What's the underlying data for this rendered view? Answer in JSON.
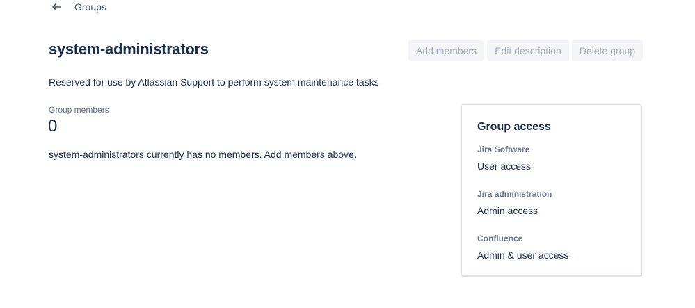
{
  "breadcrumb": {
    "back_icon": "arrow-left-icon",
    "label": "Groups"
  },
  "group": {
    "name": "system-administrators",
    "description": "Reserved for use by Atlassian Support to perform system maintenance tasks"
  },
  "actions": {
    "add_members": "Add members",
    "edit_description": "Edit description",
    "delete_group": "Delete group"
  },
  "members": {
    "label": "Group members",
    "count": "0",
    "empty_message": "system-administrators currently has no members. Add members above."
  },
  "group_access": {
    "title": "Group access",
    "items": [
      {
        "product": "Jira Software",
        "access": "User access"
      },
      {
        "product": "Jira administration",
        "access": "Admin access"
      },
      {
        "product": "Confluence",
        "access": "Admin & user access"
      }
    ]
  },
  "colors": {
    "text_primary": "#172b4d",
    "text_subtle": "#6b778c",
    "button_disabled_bg": "#f4f5f7",
    "button_disabled_text": "#a5adba",
    "card_border": "#dfe1e6"
  }
}
